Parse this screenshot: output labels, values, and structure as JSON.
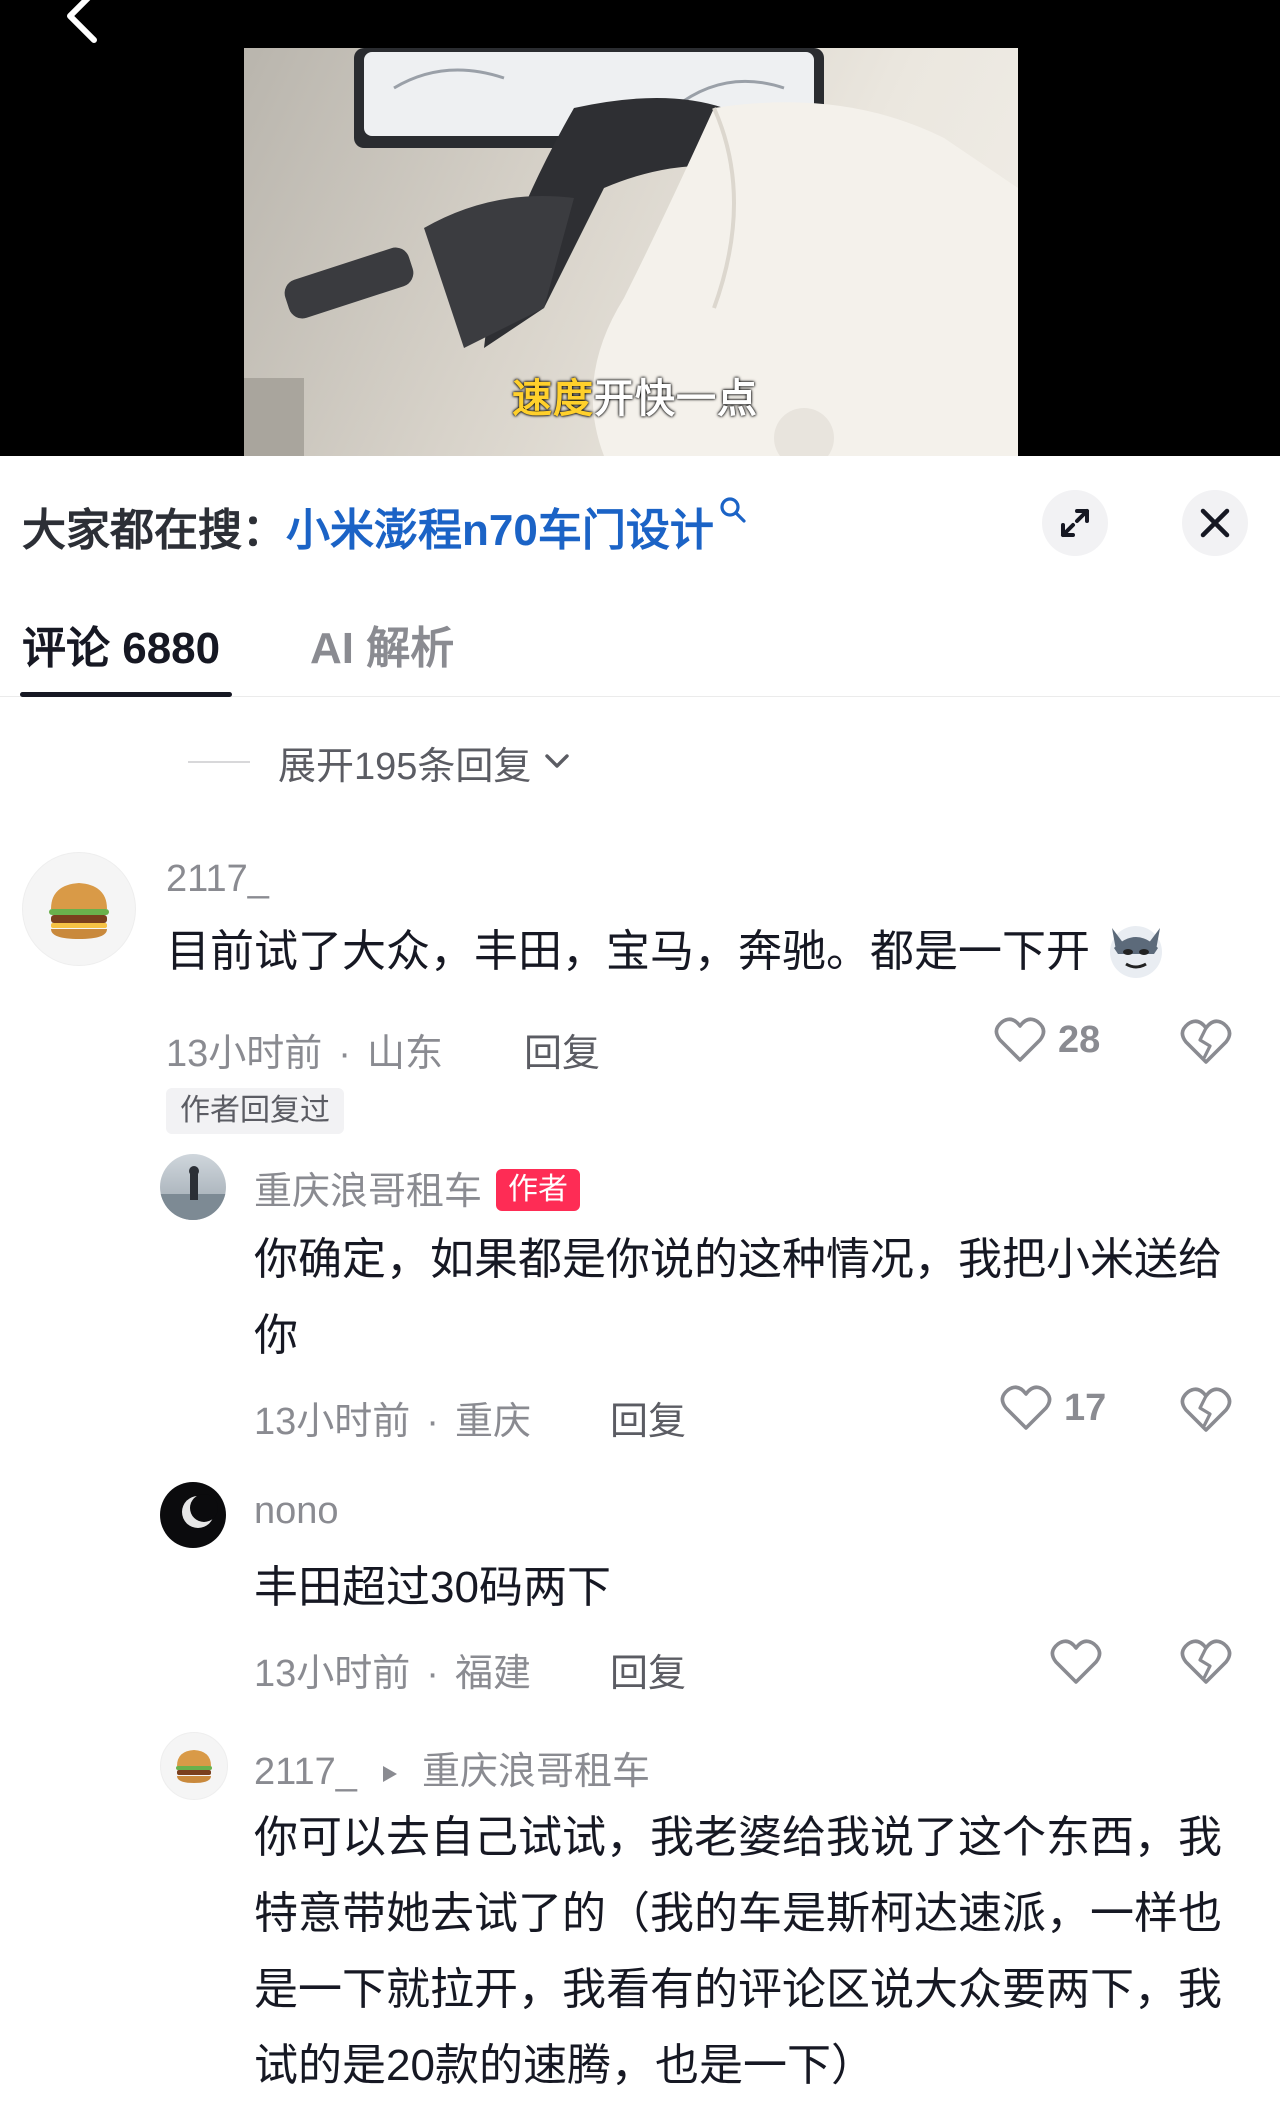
{
  "video": {
    "subtitle_highlight": "速度",
    "subtitle_rest": "开快一点"
  },
  "search": {
    "prefix": "大家都在搜：",
    "query": "小米澎程n70车门设计"
  },
  "tabs": [
    {
      "label": "评论 6880",
      "active": true
    },
    {
      "label": "AI 解析",
      "active": false
    }
  ],
  "expand_replies": "展开195条回复",
  "comments": [
    {
      "username": "2117_",
      "text": "目前试了大众，丰田，宝马，奔驰。都是一下开",
      "time": "13小时前",
      "location": "山东",
      "reply_label": "回复",
      "likes": "28",
      "tag": "作者回复过",
      "replies": [
        {
          "username": "重庆浪哥租车",
          "badge": "作者",
          "text": "你确定，如果都是你说的这种情况，我把小米送给你",
          "time": "13小时前",
          "location": "重庆",
          "reply_label": "回复",
          "likes": "17"
        },
        {
          "username": "nono",
          "text": "丰田超过30码两下",
          "time": "13小时前",
          "location": "福建",
          "reply_label": "回复",
          "likes": ""
        },
        {
          "username": "2117_",
          "reply_to": "重庆浪哥租车",
          "text": "你可以去自己试试，我老婆给我说了这个东西，我特意带她去试了的（我的车是斯柯达速派，一样也是一下就拉开，我看有的评论区说大众要两下，我试的是20款的速腾，也是一下）"
        }
      ]
    }
  ],
  "colors": {
    "link": "#1b63c6",
    "badge": "#fe2c55",
    "subtitle_highlight": "#ffd02b"
  },
  "icons": [
    "back-arrow-icon",
    "search-icon",
    "expand-icon",
    "close-icon",
    "chevron-down-icon",
    "heart-icon",
    "broken-heart-icon",
    "emoji-dog-icon",
    "play-triangle-icon"
  ]
}
